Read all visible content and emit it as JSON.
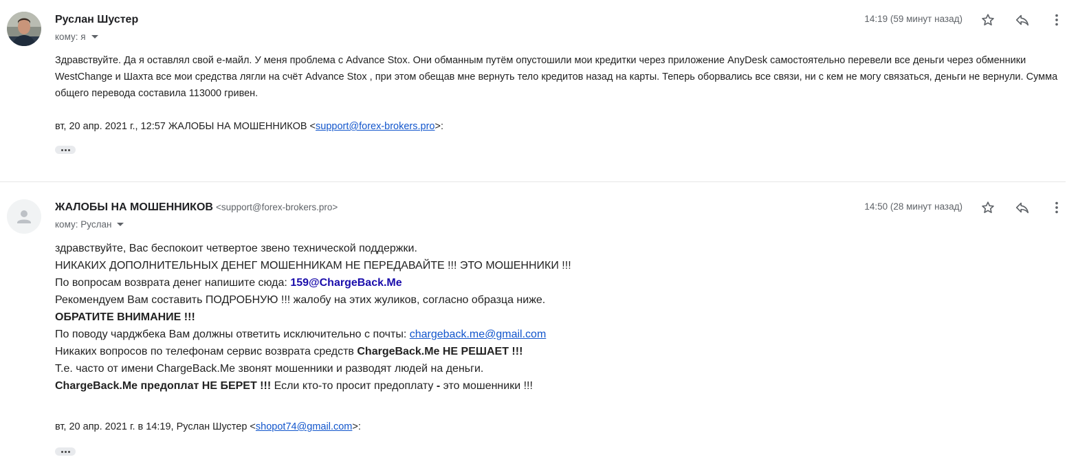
{
  "messages": [
    {
      "sender": "Руслан Шустер",
      "recipient": "кому: я",
      "time": "14:19 (59 минут назад)",
      "body": "Здравствуйте. Да я оставлял свой e-майл. У меня проблема с Advance Stox. Они обманным путём опустошили мои кредитки через приложение AnyDesk самостоятельно перевели все деньги через обменники WestChange и Шахта все мои средства лягли на счёт Advance Stox , при этом обещав мне вернуть тело кредитов назад на карты. Теперь оборвались все связи, ни с кем не могу связаться, деньги не вернули. Сумма общего перевода составила 113000 гривен.",
      "quote_prefix": "вт, 20 апр. 2021 г., 12:57 ЖАЛОБЫ НА МОШЕННИКОВ <",
      "quote_email": "support@forex-brokers.pro",
      "quote_suffix": ">:"
    },
    {
      "sender": "ЖАЛОБЫ НА МОШЕННИКОВ",
      "sender_email": "<support@forex-brokers.pro>",
      "recipient": "кому: Руслан",
      "time": "14:50 (28 минут назад)",
      "lines": {
        "l1": "здравствуйте, Вас беспокоит четвертое звено технической поддержки.",
        "l2": "НИКАКИХ ДОПОЛНИТЕЛЬНЫХ ДЕНЕГ МОШЕННИКАМ НЕ ПЕРЕДАВАЙТЕ !!! ЭТО МОШЕННИКИ !!!",
        "l3_text": "По вопросам возврата денег напишите сюда: ",
        "l3_email": "159@ChargeBack.Me",
        "l4": "Рекомендуем Вам составить ПОДРОБНУЮ !!! жалобу на этих жуликов, согласно образца ниже.",
        "l5": "ОБРАТИТЕ ВНИМАНИЕ !!!",
        "l6_text": "По поводу чарджбека Вам должны ответить исключительно с почты: ",
        "l6_email": "chargeback.me@gmail.com",
        "l7_text": "Никаких вопросов по телефонам сервис возврата средств ",
        "l7_bold": "ChargeBack.Me НЕ РЕШАЕТ !!!",
        "l8": "Т.е. часто от имени ChargeBack.Me звонят мошенники и разводят людей на деньги.",
        "l9_bold1": "ChargeBack.Me предоплат НЕ БЕРЕТ !!!",
        "l9_text1": " Если кто-то просит предоплату ",
        "l9_bold2": "-",
        "l9_text2": " это мошенники !!!"
      },
      "quote_prefix": "вт, 20 апр. 2021 г. в 14:19, Руслан Шустер <",
      "quote_email": "shopot74@gmail.com",
      "quote_suffix": ">:"
    }
  ],
  "icons": [
    "star-icon",
    "reply-icon",
    "more-vert-icon",
    "person-icon",
    "ellipsis-icon"
  ],
  "colors": {
    "link": "#1155cc",
    "highlight_email": "#1a0dab",
    "meta_text": "#5f6368"
  }
}
